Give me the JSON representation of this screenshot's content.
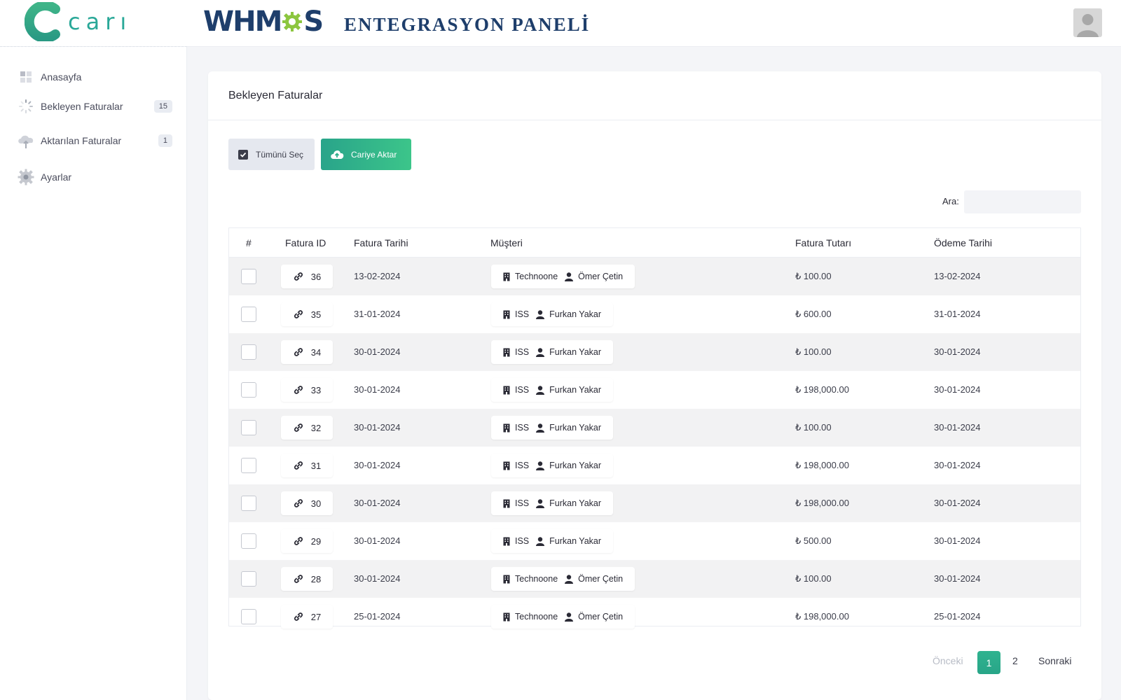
{
  "header": {
    "brand_text": "carı",
    "whmcs_pre": "WHM",
    "whmcs_post": "S",
    "panel_title": "ENTEGRASYON PANELİ"
  },
  "sidebar": {
    "items": [
      {
        "label": "Anasayfa",
        "icon": "dashboard-icon"
      },
      {
        "label": "Bekleyen Faturalar",
        "icon": "spinner-icon",
        "badge": "15"
      },
      {
        "label": "Aktarılan Faturalar",
        "icon": "cloud-upload-icon",
        "badge": "1"
      },
      {
        "label": "Ayarlar",
        "icon": "gear-icon"
      }
    ]
  },
  "card": {
    "title": "Bekleyen Faturalar",
    "select_all_label": "Tümünü Seç",
    "transfer_label": "Cariye Aktar",
    "search_label": "Ara:",
    "search_value": ""
  },
  "table": {
    "headers": [
      "#",
      "Fatura ID",
      "Fatura Tarihi",
      "Müşteri",
      "Fatura Tutarı",
      "Ödeme Tarihi"
    ],
    "rows": [
      {
        "id": "36",
        "date": "13-02-2024",
        "company": "Technoone",
        "person": "Ömer Çetin",
        "amount": "₺ 100.00",
        "paid": "13-02-2024"
      },
      {
        "id": "35",
        "date": "31-01-2024",
        "company": "ISS",
        "person": "Furkan Yakar",
        "amount": "₺ 600.00",
        "paid": "31-01-2024"
      },
      {
        "id": "34",
        "date": "30-01-2024",
        "company": "ISS",
        "person": "Furkan Yakar",
        "amount": "₺ 100.00",
        "paid": "30-01-2024"
      },
      {
        "id": "33",
        "date": "30-01-2024",
        "company": "ISS",
        "person": "Furkan Yakar",
        "amount": "₺ 198,000.00",
        "paid": "30-01-2024"
      },
      {
        "id": "32",
        "date": "30-01-2024",
        "company": "ISS",
        "person": "Furkan Yakar",
        "amount": "₺ 100.00",
        "paid": "30-01-2024"
      },
      {
        "id": "31",
        "date": "30-01-2024",
        "company": "ISS",
        "person": "Furkan Yakar",
        "amount": "₺ 198,000.00",
        "paid": "30-01-2024"
      },
      {
        "id": "30",
        "date": "30-01-2024",
        "company": "ISS",
        "person": "Furkan Yakar",
        "amount": "₺ 198,000.00",
        "paid": "30-01-2024"
      },
      {
        "id": "29",
        "date": "30-01-2024",
        "company": "ISS",
        "person": "Furkan Yakar",
        "amount": "₺ 500.00",
        "paid": "30-01-2024"
      },
      {
        "id": "28",
        "date": "30-01-2024",
        "company": "Technoone",
        "person": "Ömer Çetin",
        "amount": "₺ 100.00",
        "paid": "30-01-2024"
      },
      {
        "id": "27",
        "date": "25-01-2024",
        "company": "Technoone",
        "person": "Ömer Çetin",
        "amount": "₺ 198,000.00",
        "paid": "25-01-2024"
      }
    ]
  },
  "pagination": {
    "prev": "Önceki",
    "pages": [
      "1",
      "2"
    ],
    "current": "1",
    "next": "Sonraki"
  },
  "colors": {
    "accent": "#2fb38f",
    "brand_dark": "#1e3e6b"
  }
}
